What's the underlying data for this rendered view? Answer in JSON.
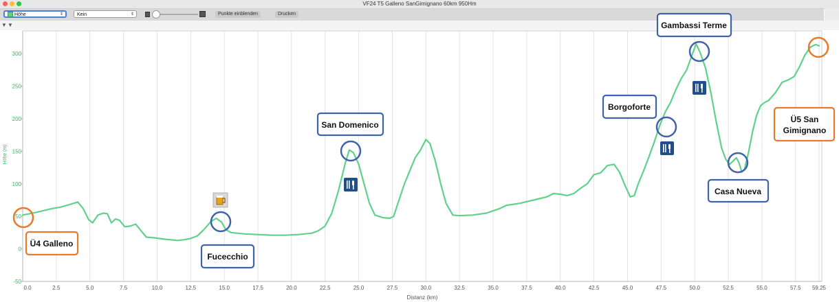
{
  "window": {
    "title": "VF24 T5 Galleno SanGimignano 60km 950Hm"
  },
  "toolbar": {
    "profile_select": "Höhe",
    "overlay_select": "Kein",
    "toggle_points": "Punkte einblenden",
    "print": "Drucken"
  },
  "chart_data": {
    "type": "line",
    "xlabel": "Distanz (km)",
    "ylabel": "Höhe (m)",
    "xlim": [
      0,
      59.25
    ],
    "ylim": [
      -50,
      335
    ],
    "x_ticks": [
      "0.0",
      "2.5",
      "5.0",
      "7.5",
      "10.0",
      "12.5",
      "15.0",
      "17.5",
      "20.0",
      "22.5",
      "25.0",
      "27.5",
      "30.0",
      "32.5",
      "35.0",
      "37.5",
      "40.0",
      "42.5",
      "45.0",
      "47.5",
      "50.0",
      "52.5",
      "55.0",
      "57.5",
      "59.25"
    ],
    "y_ticks": [
      "-50",
      "0",
      "50",
      "100",
      "150",
      "200",
      "250",
      "300"
    ],
    "grid": "vertical",
    "line_color": "#5fd18a",
    "series": [
      {
        "x": [
          0,
          0.5,
          1.2,
          1.8,
          2.2,
          2.8,
          3.3,
          3.8,
          4.1,
          4.5,
          4.9,
          5.2,
          5.6,
          6.0,
          6.3,
          6.6,
          6.9,
          7.2,
          7.6,
          8.0,
          8.4,
          8.8,
          9.2,
          9.8,
          10.5,
          11.0,
          11.5,
          12.0,
          12.5,
          13.0,
          13.5,
          14.0,
          14.4,
          14.8,
          15.1,
          15.5,
          16.0,
          16.5,
          17.5,
          18.5,
          19.5,
          20.5,
          21.5,
          22.0,
          22.5,
          23.0,
          23.5,
          24.0,
          24.3,
          24.6,
          25.0,
          25.4,
          25.8,
          26.2,
          26.8,
          27.3,
          27.6,
          28.0,
          28.4,
          28.8,
          29.2,
          29.6,
          30.0,
          30.3,
          30.7,
          31.1,
          31.5,
          32.0,
          32.5,
          33.5,
          34.5,
          35.5,
          36.0,
          37.0,
          38.0,
          39.0,
          39.5,
          40.0,
          40.5,
          41.0,
          41.5,
          42.0,
          42.5,
          43.0,
          43.5,
          44.0,
          44.4,
          44.8,
          45.2,
          45.5,
          45.8,
          46.2,
          46.6,
          47.0,
          47.4,
          47.8,
          48.2,
          48.6,
          49.0,
          49.4,
          49.8,
          50.1,
          50.4,
          50.8,
          51.2,
          51.6,
          52.0,
          52.3,
          52.6,
          52.9,
          53.1,
          53.3,
          53.5,
          53.7,
          54.0,
          54.3,
          54.6,
          54.9,
          55.2,
          55.5,
          56.0,
          56.5,
          57.0,
          57.4,
          57.8,
          58.2,
          58.6,
          59.0,
          59.25
        ],
        "y": [
          52,
          54,
          57,
          60,
          62,
          64,
          67,
          70,
          72,
          62,
          45,
          40,
          52,
          55,
          54,
          40,
          46,
          44,
          34,
          35,
          38,
          28,
          18,
          17,
          15,
          14,
          13,
          14,
          16,
          20,
          30,
          42,
          47,
          41,
          30,
          25,
          24,
          23,
          22,
          21,
          21,
          22,
          24,
          28,
          35,
          55,
          90,
          132,
          152,
          148,
          130,
          100,
          70,
          52,
          48,
          47,
          50,
          75,
          100,
          120,
          140,
          152,
          168,
          162,
          135,
          100,
          70,
          52,
          51,
          52,
          55,
          62,
          67,
          70,
          75,
          80,
          85,
          84,
          82,
          85,
          93,
          100,
          114,
          117,
          128,
          130,
          118,
          98,
          80,
          82,
          100,
          120,
          142,
          165,
          190,
          210,
          225,
          245,
          262,
          275,
          298,
          315,
          302,
          278,
          240,
          195,
          155,
          138,
          130,
          136,
          140,
          132,
          118,
          122,
          148,
          180,
          205,
          220,
          225,
          228,
          240,
          256,
          260,
          265,
          280,
          298,
          310,
          314,
          312
        ]
      }
    ]
  },
  "annotations": [
    {
      "label": "Ü4 Galleno",
      "color": "#e8792c"
    },
    {
      "label": "Fucecchio",
      "color": "#3f63a8"
    },
    {
      "label": "San Domenico",
      "color": "#3f63a8"
    },
    {
      "label": "Borgoforte",
      "color": "#3f63a8"
    },
    {
      "label": "Gambassi Terme",
      "color": "#3f63a8"
    },
    {
      "label": "Casa Nueva",
      "color": "#3f63a8"
    },
    {
      "label": "Ü5  San\nGimignano",
      "color": "#e8792c"
    }
  ],
  "colors": {
    "orange": "#e8792c",
    "blue": "#3f63a8",
    "line": "#5fd18a",
    "axis_text": "#2fb865"
  },
  "icons": [
    "restaurant-icon",
    "beer-icon",
    "orange-marker-circle",
    "blue-marker-circle"
  ]
}
